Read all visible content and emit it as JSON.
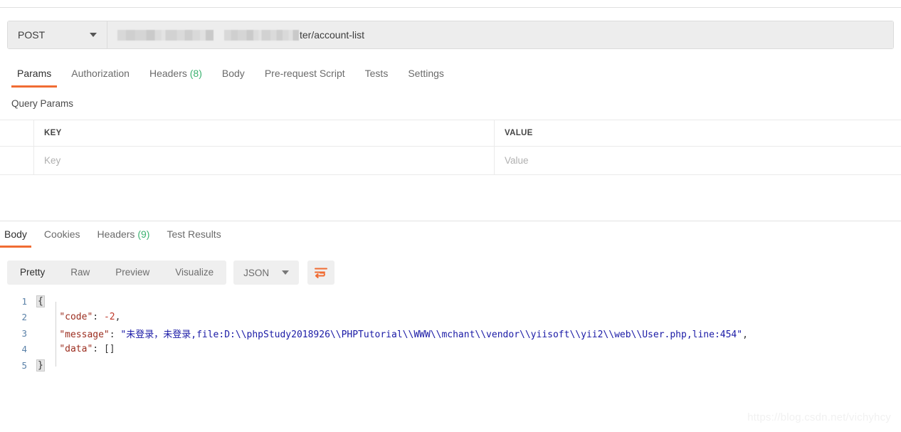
{
  "request": {
    "method": "POST",
    "url_visible_suffix": "ter/account-list",
    "url_redacted": true,
    "tabs": [
      {
        "label": "Params",
        "count": "",
        "active": true
      },
      {
        "label": "Authorization",
        "count": "",
        "active": false
      },
      {
        "label": "Headers",
        "count": "(8)",
        "active": false
      },
      {
        "label": "Body",
        "count": "",
        "active": false
      },
      {
        "label": "Pre-request Script",
        "count": "",
        "active": false
      },
      {
        "label": "Tests",
        "count": "",
        "active": false
      },
      {
        "label": "Settings",
        "count": "",
        "active": false
      }
    ],
    "params": {
      "section_title": "Query Params",
      "columns": [
        "KEY",
        "VALUE"
      ],
      "rows": [
        {
          "key_placeholder": "Key",
          "value_placeholder": "Value"
        }
      ]
    }
  },
  "response": {
    "tabs": [
      {
        "label": "Body",
        "count": "",
        "active": true
      },
      {
        "label": "Cookies",
        "count": "",
        "active": false
      },
      {
        "label": "Headers",
        "count": "(9)",
        "active": false
      },
      {
        "label": "Test Results",
        "count": "",
        "active": false
      }
    ],
    "view_modes": [
      {
        "label": "Pretty",
        "active": true
      },
      {
        "label": "Raw",
        "active": false
      },
      {
        "label": "Preview",
        "active": false
      },
      {
        "label": "Visualize",
        "active": false
      }
    ],
    "format": "JSON",
    "wrap_icon": "word-wrap-icon",
    "body": {
      "language": "json",
      "lines": [
        {
          "n": "1",
          "open_brace": "{"
        },
        {
          "n": "2",
          "key": "\"code\"",
          "sep": ": ",
          "num": "-2",
          "tail": ","
        },
        {
          "n": "3",
          "key": "\"message\"",
          "sep": ": ",
          "str": "\"未登录，未登录,file:D:\\\\phpStudy2018926\\\\PHPTutorial\\\\WWW\\\\mchant\\\\vendor\\\\yiisoft\\\\yii2\\\\web\\\\User.php,line:454\"",
          "tail": ","
        },
        {
          "n": "4",
          "key": "\"data\"",
          "sep": ": ",
          "punct": "[]"
        },
        {
          "n": "5",
          "close_brace": "}"
        }
      ]
    }
  },
  "watermark": "https://blog.csdn.net/vichyhcy",
  "colors": {
    "accent_orange": "#f06c33",
    "count_green": "#3cb371",
    "json_key": "#9b2d1f",
    "json_string": "#1a1aa6",
    "json_number": "#c0392b",
    "line_number": "#5a81a8"
  }
}
